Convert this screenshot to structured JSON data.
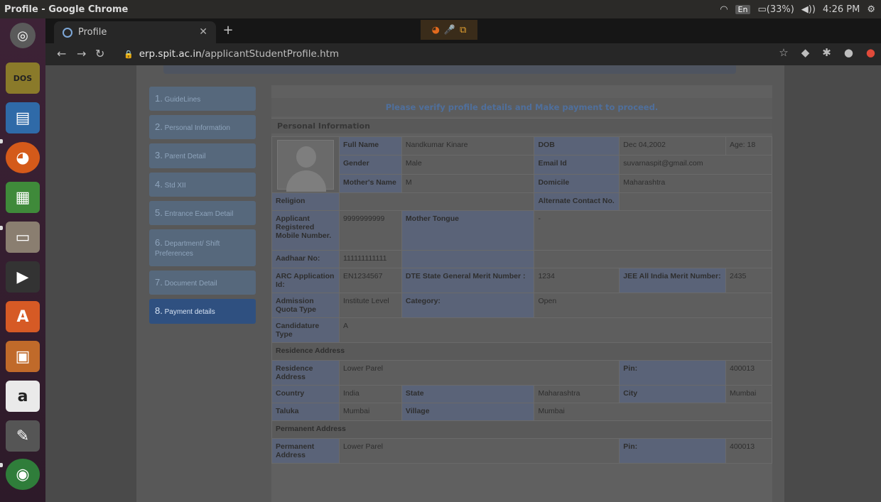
{
  "system": {
    "window_title": "Profile - Google Chrome",
    "lang": "En",
    "battery": "(33%)",
    "time": "4:26 PM"
  },
  "launcher": {
    "apps": [
      "ubuntu-icon",
      "dosbox-icon",
      "writer-icon",
      "firefox-icon",
      "calc-icon",
      "files-icon",
      "video-editor-icon",
      "software-center-icon",
      "impress-icon",
      "amazon-icon",
      "settings-icon",
      "chrome-icon",
      "disk-icon"
    ]
  },
  "browser": {
    "tab_title": "Profile",
    "url_domain": "erp.spit.ac.in",
    "url_path": "/applicantStudentProfile.htm"
  },
  "steps": [
    {
      "num": "1.",
      "label": "GuideLines",
      "active": false
    },
    {
      "num": "2.",
      "label": "Personal Information",
      "active": false
    },
    {
      "num": "3.",
      "label": "Parent Detail",
      "active": false
    },
    {
      "num": "4.",
      "label": "Std XII",
      "active": false
    },
    {
      "num": "5.",
      "label": "Entrance Exam Detail",
      "active": false
    },
    {
      "num": "6.",
      "label": "Department/ Shift Preferences",
      "active": false
    },
    {
      "num": "7.",
      "label": "Document Detail",
      "active": false
    },
    {
      "num": "8.",
      "label": "Payment details",
      "active": true
    }
  ],
  "notice": "Please verify profile details and Make payment to proceed.",
  "personal_header": "Personal Information",
  "profile": {
    "full_name_label": "Full Name",
    "full_name": "Nandkumar Kinare",
    "dob_label": "DOB",
    "dob": "Dec 04,2002",
    "age": "Age: 18",
    "gender_label": "Gender",
    "gender": "Male",
    "email_label": "Email Id",
    "email": "suvarnaspit@gmail.com",
    "mother_label": "Mother's Name",
    "mother": "M",
    "domicile_label": "Domicile",
    "domicile": "Maharashtra",
    "religion_label": "Religion",
    "religion": "",
    "alt_contact_label": "Alternate Contact No.",
    "alt_contact": "",
    "mobile_label": "Applicant Registered Mobile Number.",
    "mobile": "9999999999",
    "tongue_label": "Mother Tongue",
    "tongue": "-",
    "aadhaar_label": "Aadhaar No:",
    "aadhaar": "111111111111",
    "arc_label": "ARC Application Id:",
    "arc": "EN1234567",
    "dte_label": "DTE State General Merit Number :",
    "dte": "1234",
    "jee_label": "JEE All India Merit Number:",
    "jee": "2435",
    "quota_label": "Admission Quota Type",
    "quota": "Institute Level",
    "category_label": "Category:",
    "category": "Open",
    "candidature_label": "Candidature Type",
    "candidature": "A"
  },
  "residence": {
    "header": "Residence Address",
    "address_label": "Residence Address",
    "address": "Lower Parel",
    "pin_label": "Pin:",
    "pin": "400013",
    "country_label": "Country",
    "country": "India",
    "state_label": "State",
    "state": "Maharashtra",
    "city_label": "City",
    "city": "Mumbai",
    "taluka_label": "Taluka",
    "taluka": "Mumbai",
    "village_label": "Village",
    "village": "Mumbai"
  },
  "permanent": {
    "header": "Permanent Address",
    "address_label": "Permanent Address",
    "address": "Lower Parel",
    "pin_label": "Pin:",
    "pin": "400013"
  }
}
